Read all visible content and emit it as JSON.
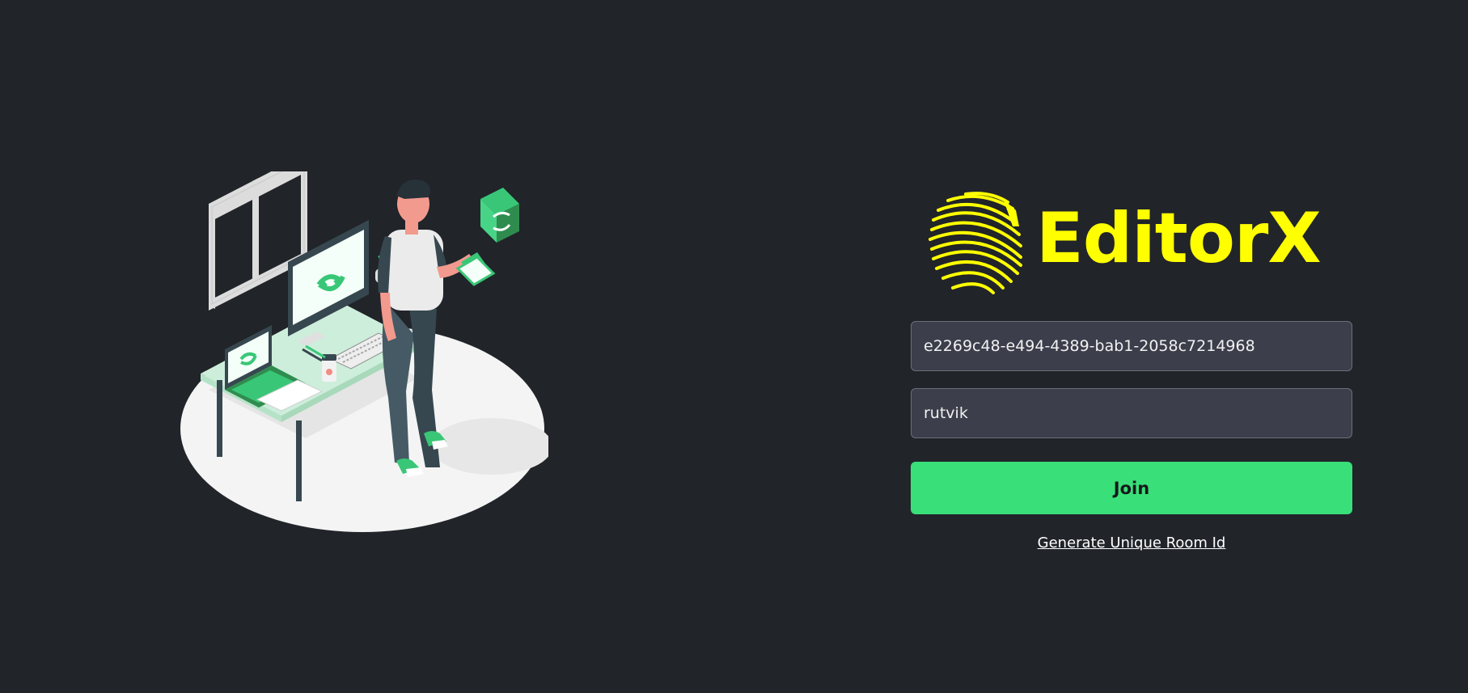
{
  "brand": {
    "name": "EditorX",
    "color": "#ffff00"
  },
  "illustration": {
    "icon": "person-at-desk-sync-illustration",
    "accent": "#39c777"
  },
  "form": {
    "room_id": {
      "value": "e2269c48-e494-4389-bab1-2058c7214968",
      "placeholder": ""
    },
    "username": {
      "value": "rutvik",
      "placeholder": ""
    },
    "join_label": "Join",
    "join_color": "#39e079",
    "generate_link": "Generate Unique Room Id"
  },
  "colors": {
    "background": "#212429",
    "input_background": "#3c3e4b"
  }
}
